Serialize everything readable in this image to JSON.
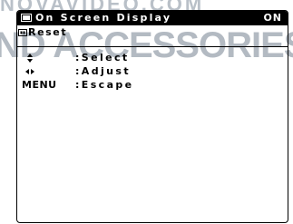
{
  "watermark": {
    "top_text": "NOVAVIDEO.COM",
    "main_text": "AND ACCESSORIES"
  },
  "osd": {
    "header": {
      "icon": "monitor-icon",
      "title": "On Screen Display",
      "value": "ON"
    },
    "items": [
      {
        "icon": "reset-icon",
        "label": "Reset"
      }
    ],
    "help": [
      {
        "key_icon": "up-down-arrows-icon",
        "key": "",
        "action": ":Select"
      },
      {
        "key_icon": "left-right-arrows-icon",
        "key": "",
        "action": ":Adjust"
      },
      {
        "key_icon": "",
        "key": "MENU",
        "action": ":Escape"
      }
    ]
  }
}
